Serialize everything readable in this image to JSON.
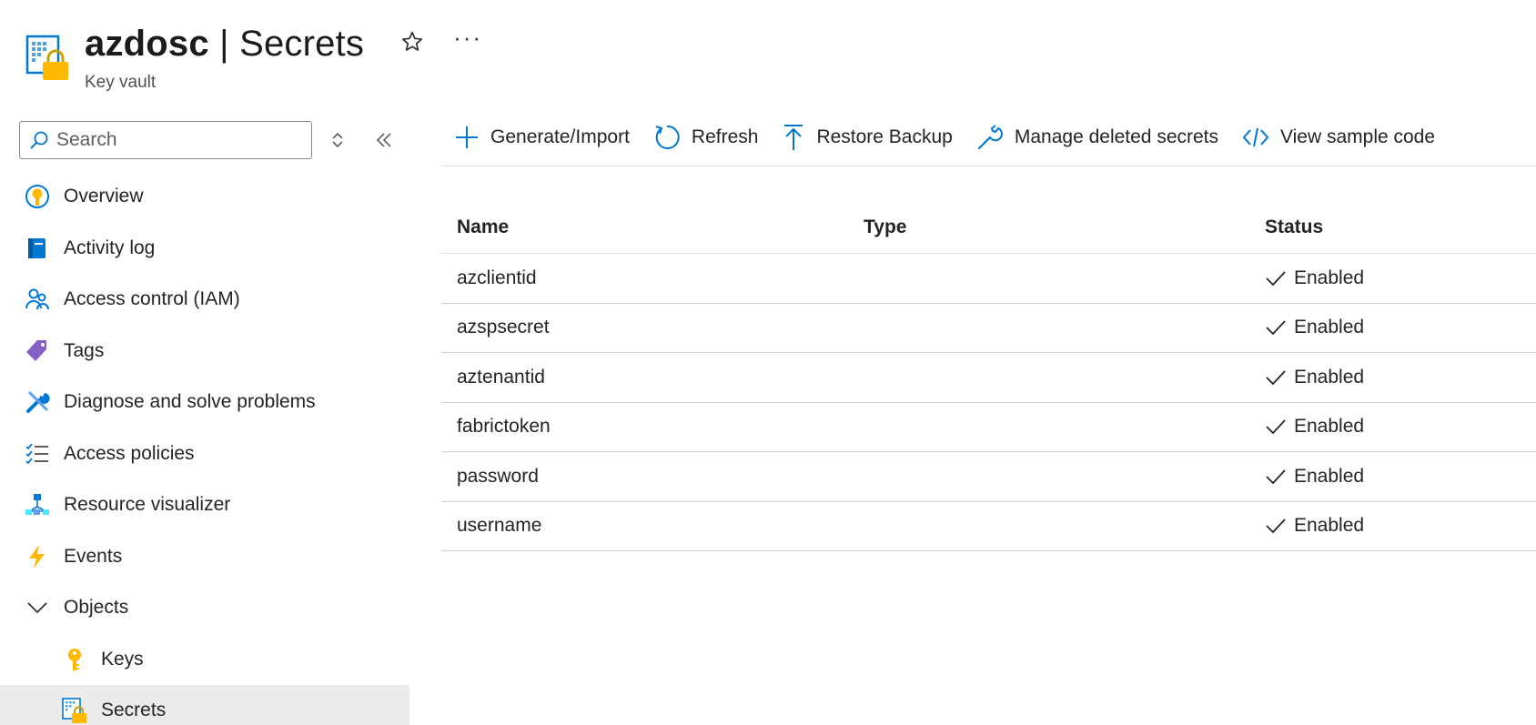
{
  "header": {
    "resource_name": "azdosc",
    "separator": "|",
    "page": "Secrets",
    "subtitle": "Key vault",
    "favorite_icon": "star-icon",
    "more_label": "···"
  },
  "sidebar": {
    "search": {
      "placeholder": "Search",
      "value": ""
    },
    "items": [
      {
        "label": "Overview",
        "icon": "overview-icon"
      },
      {
        "label": "Activity log",
        "icon": "activity-log-icon"
      },
      {
        "label": "Access control (IAM)",
        "icon": "iam-icon"
      },
      {
        "label": "Tags",
        "icon": "tag-icon"
      },
      {
        "label": "Diagnose and solve problems",
        "icon": "wrench-icon"
      },
      {
        "label": "Access policies",
        "icon": "access-policies-icon"
      },
      {
        "label": "Resource visualizer",
        "icon": "resource-visualizer-icon"
      },
      {
        "label": "Events",
        "icon": "lightning-icon"
      },
      {
        "label": "Objects",
        "icon": "chevron-down-icon"
      },
      {
        "label": "Keys",
        "icon": "key-icon"
      },
      {
        "label": "Secrets",
        "icon": "secrets-icon",
        "selected": true
      }
    ]
  },
  "toolbar": {
    "generate_import": "Generate/Import",
    "refresh": "Refresh",
    "restore_backup": "Restore Backup",
    "manage_deleted": "Manage deleted secrets",
    "view_sample_code": "View sample code"
  },
  "table": {
    "columns": {
      "name": "Name",
      "type": "Type",
      "status": "Status"
    },
    "rows": [
      {
        "name": "azclientid",
        "type": "",
        "status": "Enabled"
      },
      {
        "name": "azspsecret",
        "type": "",
        "status": "Enabled"
      },
      {
        "name": "aztenantid",
        "type": "",
        "status": "Enabled"
      },
      {
        "name": "fabrictoken",
        "type": "",
        "status": "Enabled"
      },
      {
        "name": "password",
        "type": "",
        "status": "Enabled"
      },
      {
        "name": "username",
        "type": "",
        "status": "Enabled"
      }
    ]
  },
  "colors": {
    "accent": "#0078d4",
    "selected_bg": "#edebe9",
    "divider": "#e1dfdd",
    "key_yellow": "#ffb900"
  }
}
